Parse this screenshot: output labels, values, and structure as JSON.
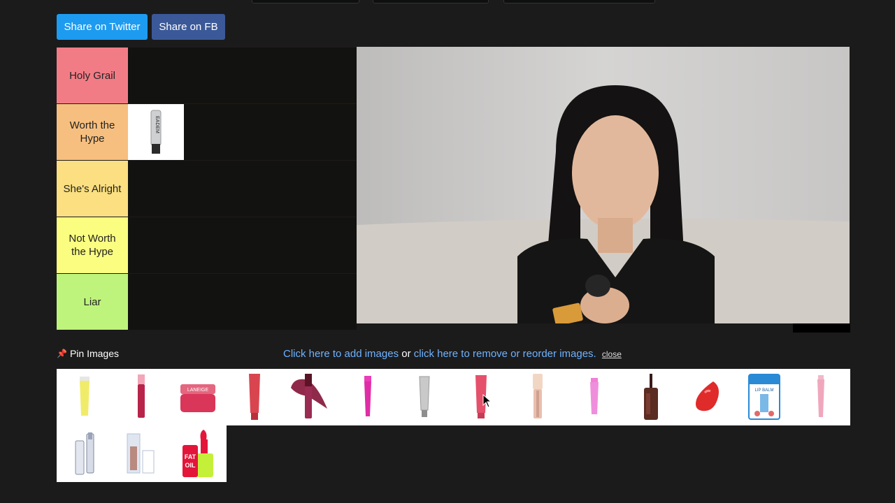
{
  "share": {
    "twitter": "Share on Twitter",
    "fb": "Share on FB"
  },
  "tiers": [
    {
      "label": "Holy Grail",
      "color": "#f27c86"
    },
    {
      "label": "Worth the Hype",
      "color": "#f7bf7f"
    },
    {
      "label": "She's Alright",
      "color": "#fbdf80"
    },
    {
      "label": "Not Worth the Hype",
      "color": "#fbfd80"
    },
    {
      "label": "Liar",
      "color": "#bef47b"
    }
  ],
  "tier_item_text": "EADEM",
  "pin": {
    "label": "Pin Images",
    "add_link": "Click here to add images",
    "or_text": "or",
    "remove_link": "click here to remove or reorder images.",
    "close": "close"
  },
  "product_text": {
    "laneige": "LANEIGE",
    "fat": "FAT",
    "oil": "OIL",
    "lip_balm": "LIP BALM"
  }
}
